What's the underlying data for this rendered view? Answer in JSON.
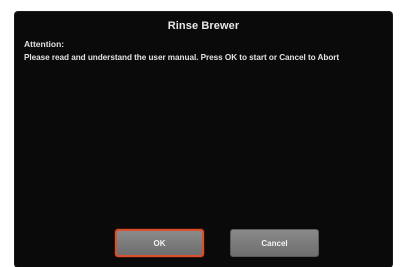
{
  "dialog": {
    "title": "Rinse Brewer",
    "heading": "Attention:",
    "message": "Please read and understand the user manual.  Press OK to start or Cancel to Abort"
  },
  "buttons": {
    "ok_label": "OK",
    "cancel_label": "Cancel"
  },
  "colors": {
    "screen_background": "#0a0a0a",
    "button_fill": "#7a7a7a",
    "highlight_border": "#d9502e",
    "text": "#e2e2e2"
  }
}
